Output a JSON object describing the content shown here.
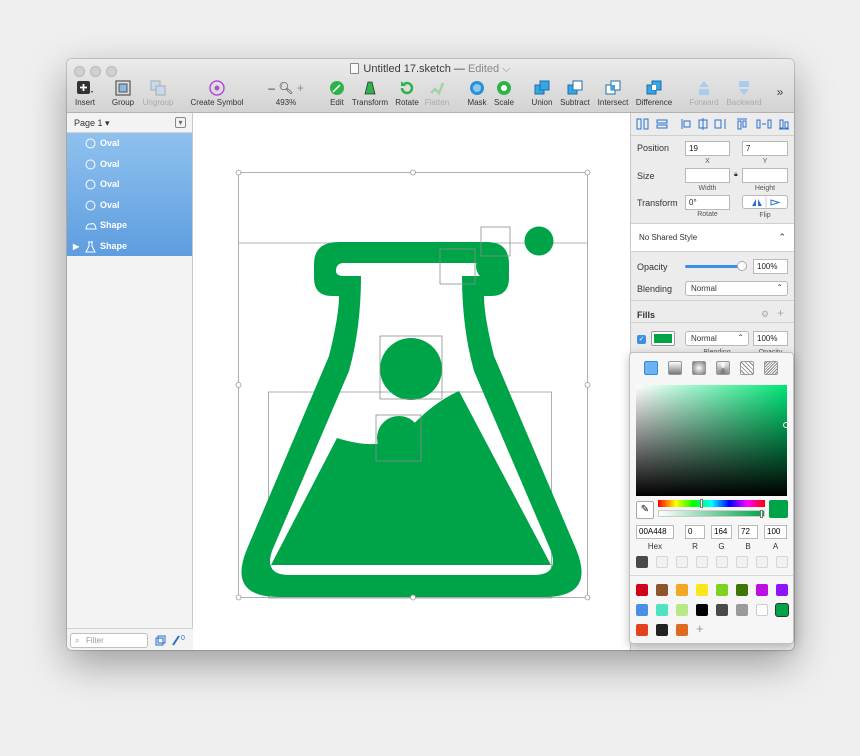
{
  "window": {
    "title": "Untitled 17.sketch",
    "title_sep": "—",
    "edited": "Edited"
  },
  "toolbar": {
    "insert": "Insert",
    "group": "Group",
    "ungroup": "Ungroup",
    "create_symbol": "Create Symbol",
    "zoom_minus": "–",
    "zoom_plus": "+",
    "zoom_value": "493%",
    "edit": "Edit",
    "transform": "Transform",
    "rotate": "Rotate",
    "flatten": "Flatten",
    "mask": "Mask",
    "scale": "Scale",
    "union": "Union",
    "subtract": "Subtract",
    "intersect": "Intersect",
    "difference": "Difference",
    "forward": "Forward",
    "backward": "Backward",
    "more": "»"
  },
  "sidebar": {
    "page": "Page 1",
    "page_caret": "▾",
    "layers": [
      {
        "name": "Oval",
        "icon": "oval-icon"
      },
      {
        "name": "Oval",
        "icon": "oval-icon"
      },
      {
        "name": "Oval",
        "icon": "oval-icon"
      },
      {
        "name": "Oval",
        "icon": "oval-icon"
      },
      {
        "name": "Shape",
        "icon": "shape-icon"
      },
      {
        "name": "Shape",
        "icon": "flask-icon"
      }
    ],
    "filter_placeholder": "Filter",
    "bottom_count": "0"
  },
  "inspector": {
    "position_label": "Position",
    "position_x": "19",
    "position_y": "7",
    "x_label": "X",
    "y_label": "Y",
    "size_label": "Size",
    "width_value": "",
    "height_value": "",
    "width_label": "Width",
    "height_label": "Height",
    "transform_label": "Transform",
    "rotate_value": "0°",
    "rotate_label": "Rotate",
    "flip_label": "Flip",
    "shared_style": "No Shared Style",
    "opacity_label": "Opacity",
    "opacity_value": "100%",
    "opacity_level": 1.0,
    "blending_label": "Blending",
    "blending_value": "Normal",
    "fills_label": "Fills",
    "fill_blend": "Normal",
    "fill_opacity": "100%",
    "fill_blend_label": "Blending",
    "fill_opacity_label": "Opacity",
    "fill_color": "#00A448"
  },
  "color_picker": {
    "hex": "00A448",
    "r": "0",
    "g": "164",
    "b": "72",
    "a": "100",
    "hex_label": "Hex",
    "r_label": "R",
    "g_label": "G",
    "b_label": "B",
    "a_label": "A",
    "current_color": "#00A448",
    "preset_colors": [
      "#d0021b",
      "#8b572a",
      "#f5a623",
      "#f8e71c",
      "#7ed321",
      "#417505",
      "#bd10e0",
      "#9013fe",
      "#4a90e2",
      "#50e3c2",
      "#b8e986",
      "#000000",
      "#4a4a4a",
      "#9b9b9b",
      "#ffffff",
      "#00a448",
      "#e2431e",
      "#222222",
      "#e06a1f"
    ],
    "add_symbol": "+"
  },
  "colors": {
    "accent_green": "#00A448",
    "selection_blue": "#5e9de0"
  }
}
